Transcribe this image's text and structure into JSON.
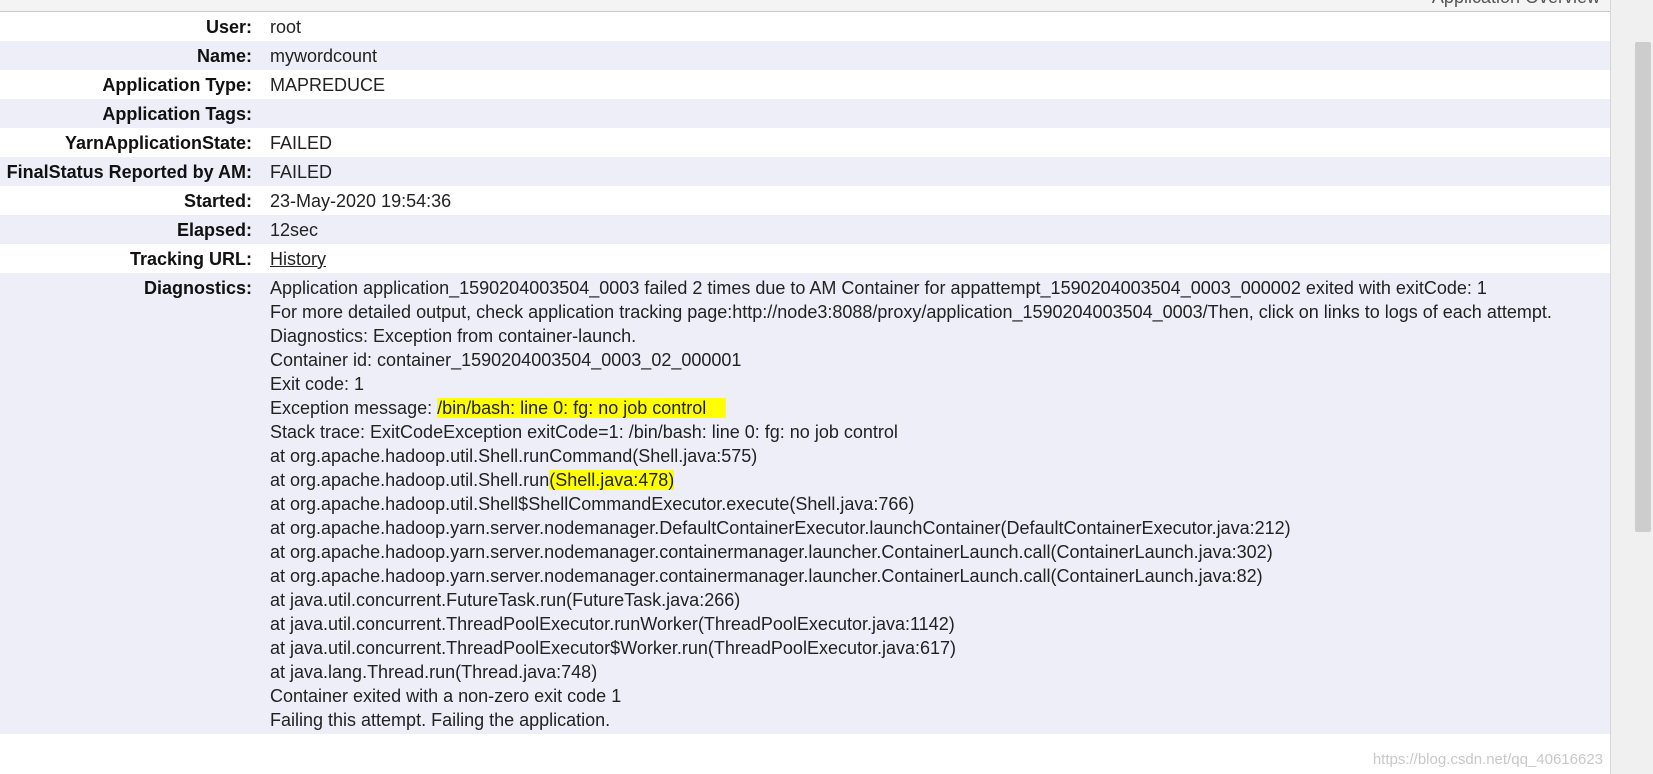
{
  "panel": {
    "title": "Application Overview"
  },
  "rows": {
    "user": {
      "label": "User:",
      "value": "root"
    },
    "name": {
      "label": "Name:",
      "value": "mywordcount"
    },
    "app_type": {
      "label": "Application Type:",
      "value": "MAPREDUCE"
    },
    "app_tags": {
      "label": "Application Tags:",
      "value": ""
    },
    "yarn_state": {
      "label": "YarnApplicationState:",
      "value": "FAILED"
    },
    "final_status": {
      "label": "FinalStatus Reported by AM:",
      "value": "FAILED"
    },
    "started": {
      "label": "Started:",
      "value": "23-May-2020 19:54:36"
    },
    "elapsed": {
      "label": "Elapsed:",
      "value": "12sec"
    },
    "tracking_url": {
      "label": "Tracking URL:",
      "value": "History"
    },
    "diagnostics": {
      "label": "Diagnostics:",
      "line_1": "Application application_1590204003504_0003 failed 2 times due to AM Container for appattempt_1590204003504_0003_000002 exited with exitCode: 1",
      "line_2": "For more detailed output, check application tracking page:http://node3:8088/proxy/application_1590204003504_0003/Then, click on links to logs of each attempt.",
      "line_3": "Diagnostics: Exception from container-launch.",
      "line_4": "Container id: container_1590204003504_0003_02_000001",
      "line_5": "Exit code: 1",
      "exception_prefix": "Exception message: ",
      "exception_message": "/bin/bash: line 0: fg: no job control",
      "line_7": "Stack trace: ExitCodeException exitCode=1: /bin/bash: line 0: fg: no job control",
      "line_8": "at org.apache.hadoop.util.Shell.runCommand(Shell.java:575)",
      "line_9_prefix": "at org.apache.hadoop.util.Shell.run",
      "line_9_highlight": "(Shell.java:478)",
      "line_10": "at org.apache.hadoop.util.Shell$ShellCommandExecutor.execute(Shell.java:766)",
      "line_11": "at org.apache.hadoop.yarn.server.nodemanager.DefaultContainerExecutor.launchContainer(DefaultContainerExecutor.java:212)",
      "line_12": "at org.apache.hadoop.yarn.server.nodemanager.containermanager.launcher.ContainerLaunch.call(ContainerLaunch.java:302)",
      "line_13": "at org.apache.hadoop.yarn.server.nodemanager.containermanager.launcher.ContainerLaunch.call(ContainerLaunch.java:82)",
      "line_14": "at java.util.concurrent.FutureTask.run(FutureTask.java:266)",
      "line_15": "at java.util.concurrent.ThreadPoolExecutor.runWorker(ThreadPoolExecutor.java:1142)",
      "line_16": "at java.util.concurrent.ThreadPoolExecutor$Worker.run(ThreadPoolExecutor.java:617)",
      "line_17": "at java.lang.Thread.run(Thread.java:748)",
      "line_18": "Container exited with a non-zero exit code 1",
      "line_19": "Failing this attempt. Failing the application."
    }
  },
  "watermark": "https://blog.csdn.net/qq_40616623",
  "colors": {
    "highlight": "#ffff00",
    "row_alt": "#eeeef9"
  }
}
